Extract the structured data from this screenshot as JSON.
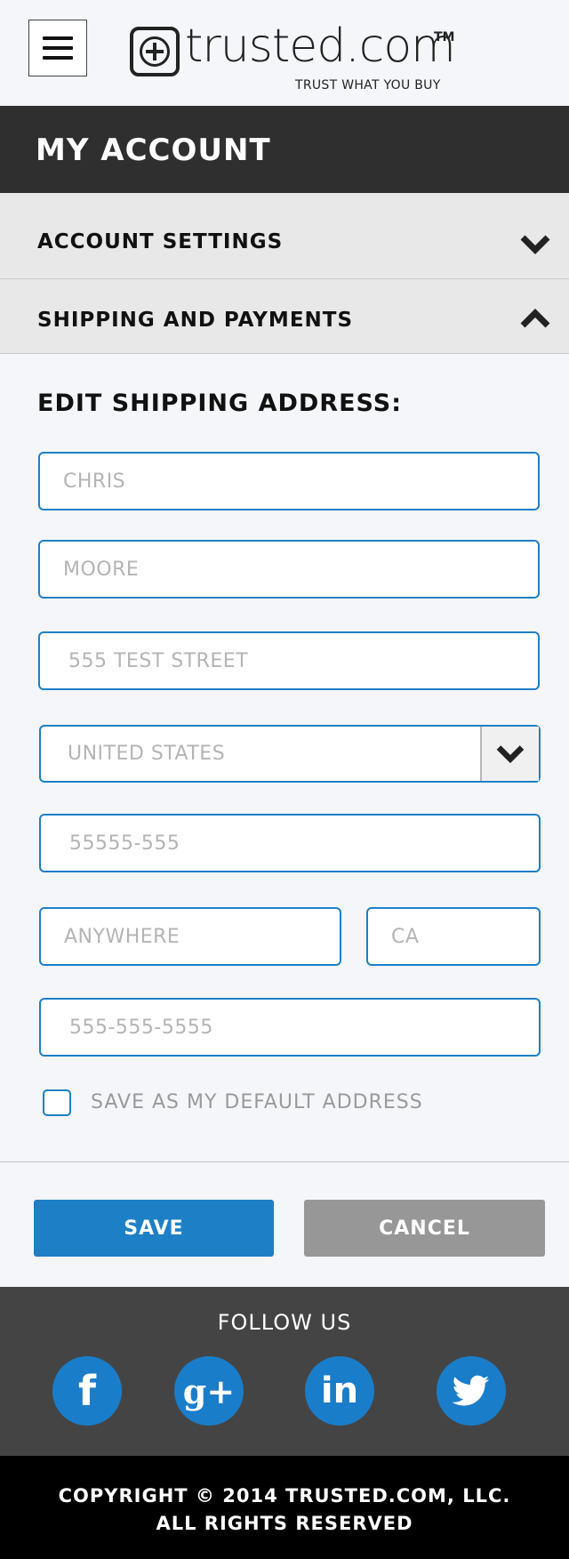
{
  "header": {
    "logo_text": "trusted.com",
    "logo_tm": "TM",
    "logo_tagline": "TRUST WHAT YOU BUY"
  },
  "page_title": "MY ACCOUNT",
  "accordion": {
    "account_settings": "ACCOUNT SETTINGS",
    "shipping_payments": "SHIPPING AND PAYMENTS"
  },
  "form": {
    "heading": "EDIT SHIPPING ADDRESS:",
    "first_name": "CHRIS",
    "last_name": "MOORE",
    "street": "555 TEST STREET",
    "country": "UNITED STATES",
    "zip": "55555-555",
    "city": "ANYWHERE",
    "state": "CA",
    "phone": "555-555-5555",
    "default_checkbox_label": "SAVE AS MY DEFAULT ADDRESS",
    "save_label": "SAVE",
    "cancel_label": "CANCEL"
  },
  "footer": {
    "follow_label": "FOLLOW US",
    "social": [
      {
        "name": "facebook-icon",
        "glyph": "f"
      },
      {
        "name": "google-plus-icon",
        "glyph": "g+"
      },
      {
        "name": "linkedin-icon",
        "glyph": "in"
      },
      {
        "name": "twitter-icon",
        "glyph": "bird"
      }
    ],
    "copyright_line1": "COPYRIGHT © 2014 TRUSTED.COM, LLC.",
    "copyright_line2": "ALL RIGHTS RESERVED"
  },
  "colors": {
    "accent": "#1d7fc6",
    "title_bar": "#2f2f2f",
    "footer": "#444444",
    "cancel": "#979797"
  }
}
